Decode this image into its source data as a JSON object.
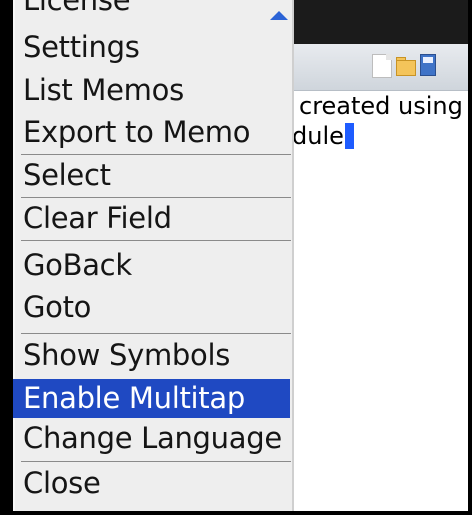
{
  "app": {
    "content_line1": "created using",
    "content_line2": "dule"
  },
  "toolbar": {
    "icons": [
      "new-document-icon",
      "open-folder-icon",
      "save-icon"
    ]
  },
  "menu": {
    "items": [
      {
        "label": "License",
        "highlighted": false
      },
      {
        "label": "Settings",
        "highlighted": false
      },
      {
        "label": "List Memos",
        "highlighted": false
      },
      {
        "label": "Export to Memo",
        "highlighted": false
      },
      {
        "label": "Select",
        "highlighted": false
      },
      {
        "label": "Clear Field",
        "highlighted": false
      },
      {
        "label": "GoBack",
        "highlighted": false
      },
      {
        "label": "Goto",
        "highlighted": false
      },
      {
        "label": "Show Symbols",
        "highlighted": false
      },
      {
        "label": "Enable Multitap",
        "highlighted": true
      },
      {
        "label": "Change Language",
        "highlighted": false
      },
      {
        "label": "Close",
        "highlighted": false
      }
    ]
  },
  "colors": {
    "highlight": "#1f49c2",
    "cursor": "#1e5cff",
    "scroll_arrow": "#2b63d6"
  }
}
